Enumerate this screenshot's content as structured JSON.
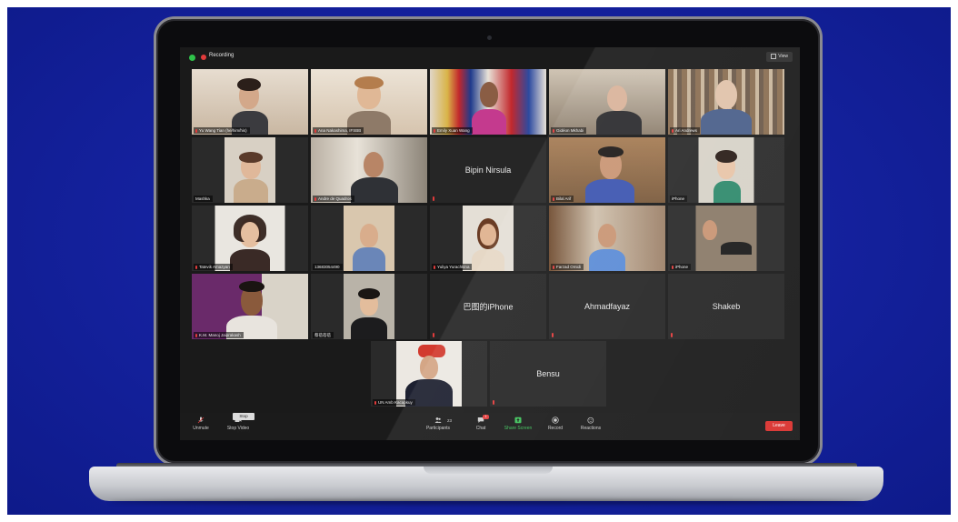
{
  "meeting": {
    "recording_label": "Recording",
    "view_label": "View"
  },
  "tiles": [
    {
      "name": "Yu Wang Tian (he/him/his)",
      "type": "video"
    },
    {
      "name": "Ana Nakashima, IFSBB",
      "type": "video"
    },
    {
      "name": "Emily Xuan Wang",
      "type": "video"
    },
    {
      "name": "Gidéon Mkhabi",
      "type": "video"
    },
    {
      "name": "Ari Andrews",
      "type": "video"
    },
    {
      "name": "Mashka",
      "type": "video"
    },
    {
      "name": "Andre de Quadros",
      "type": "video"
    },
    {
      "name": "Bipin Nirsula",
      "type": "name"
    },
    {
      "name": "Bilal Arif",
      "type": "video"
    },
    {
      "name": "iPhone",
      "type": "video"
    },
    {
      "name": "Tatevik Amazyan",
      "type": "video"
    },
    {
      "name": "13683054490",
      "type": "video"
    },
    {
      "name": "Yuliya Yurachkina",
      "type": "video"
    },
    {
      "name": "Farzad Omidi",
      "type": "video"
    },
    {
      "name": "iPhone",
      "type": "video"
    },
    {
      "name": "K.M. Manoj Jaiprakash",
      "type": "video"
    },
    {
      "name": "蔡蓓蓓蓓",
      "type": "video"
    },
    {
      "name": "巴图的iPhone",
      "type": "name"
    },
    {
      "name": "Ahmadfayaz",
      "type": "name"
    },
    {
      "name": "Shakeb",
      "type": "name"
    },
    {
      "name": "UN Amb Kacapkuy",
      "type": "video"
    },
    {
      "name": "Bensu",
      "type": "name"
    }
  ],
  "toolbar": {
    "unmute": "Unmute",
    "stop_video": "Stop Video",
    "tooltip": "Stop Video (Alt+V)",
    "participants": "Participants",
    "participants_count": "23",
    "chat": "Chat",
    "chat_badge": "1",
    "share_screen": "Share Screen",
    "record": "Record",
    "reactions": "Reactions",
    "leave": "Leave"
  },
  "colors": {
    "background": "#1522a0",
    "share_green": "#3ec25a",
    "leave_red": "#d9312e",
    "active_speaker": "#c6d64a",
    "mic_muted": "#e23b3b"
  }
}
